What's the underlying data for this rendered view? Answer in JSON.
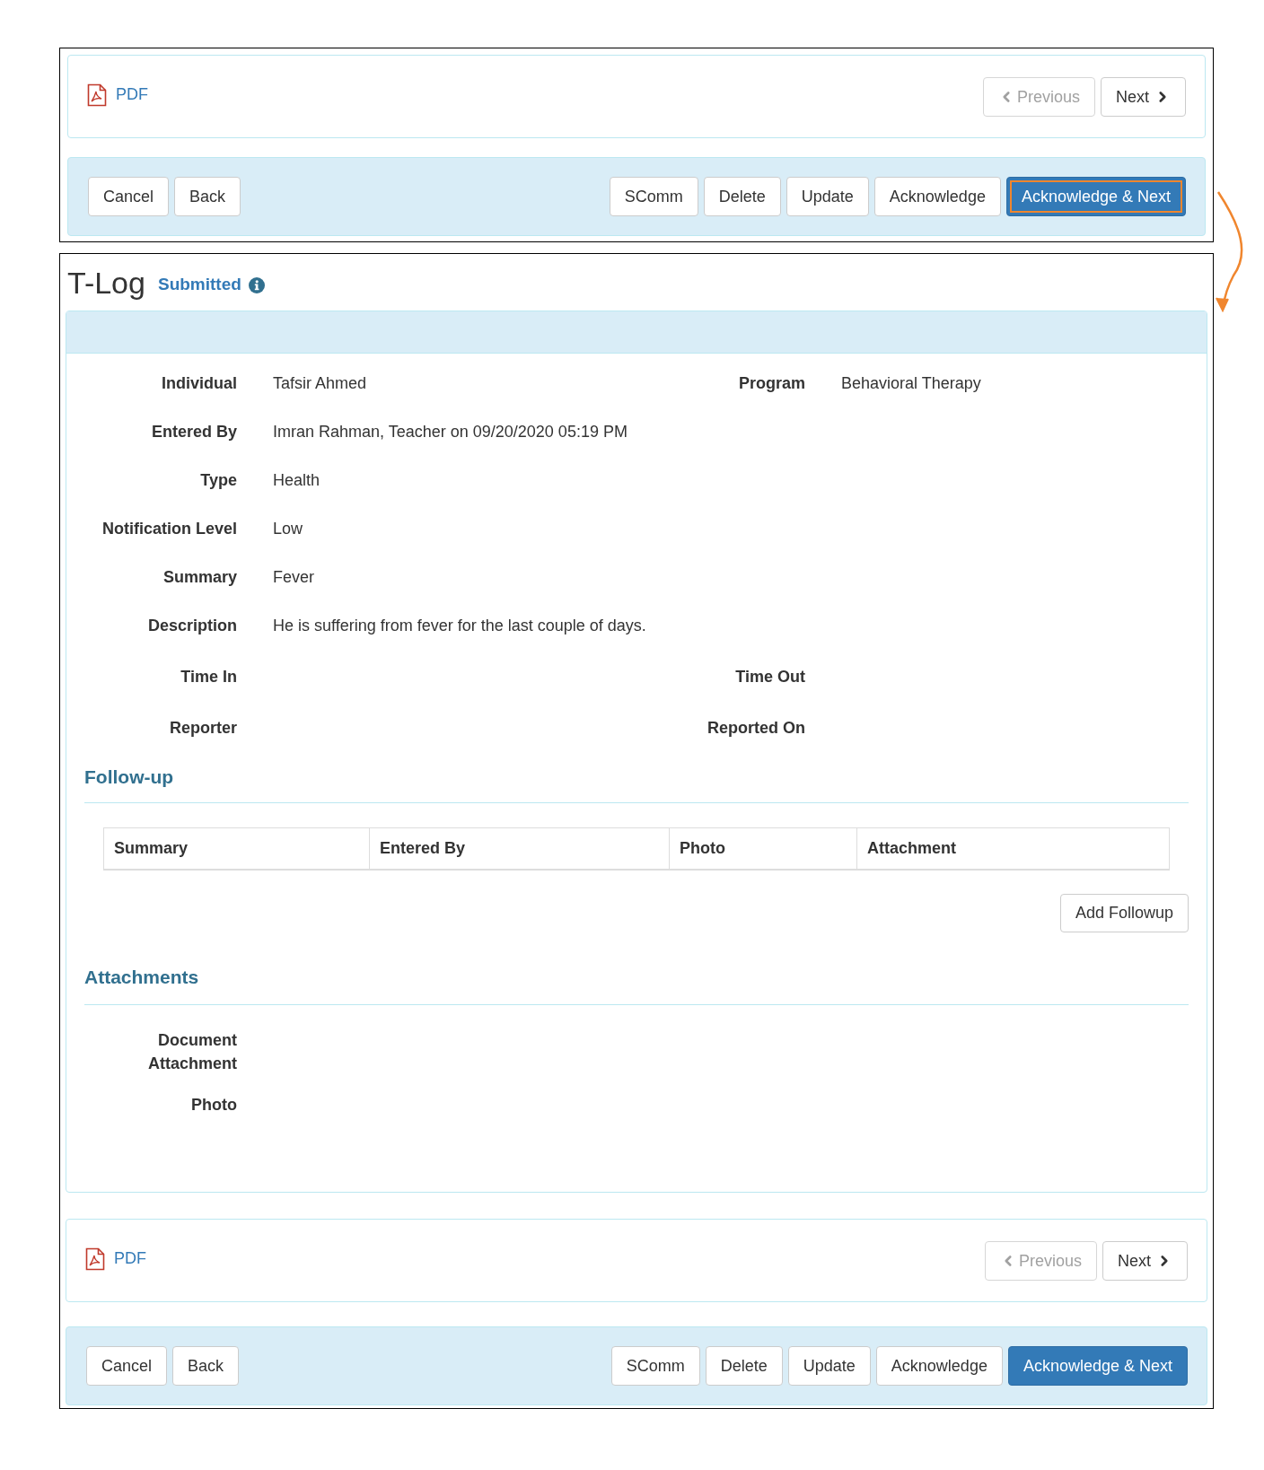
{
  "top_section": {
    "pdf_link": "PDF",
    "previous_button": {
      "label": "Previous",
      "disabled": true
    },
    "next_button": {
      "label": "Next",
      "disabled": false
    },
    "actions_left": [
      "Cancel",
      "Back"
    ],
    "actions_right": [
      {
        "label": "SComm",
        "kind": "default",
        "highlighted": false
      },
      {
        "label": "Delete",
        "kind": "default",
        "highlighted": false
      },
      {
        "label": "Update",
        "kind": "default",
        "highlighted": false
      },
      {
        "label": "Acknowledge",
        "kind": "default",
        "highlighted": false
      },
      {
        "label": "Acknowledge & Next",
        "kind": "primary",
        "highlighted": true
      }
    ]
  },
  "record": {
    "title": "T-Log",
    "status": "Submitted",
    "fields": [
      [
        {
          "label": "Individual",
          "value": "Tafsir Ahmed"
        },
        {
          "label": "Program",
          "value": "Behavioral Therapy"
        }
      ],
      [
        {
          "label": "Entered By",
          "value": "Imran Rahman, Teacher on 09/20/2020 05:19 PM"
        }
      ],
      [
        {
          "label": "Type",
          "value": "Health"
        }
      ],
      [
        {
          "label": "Notification Level",
          "value": "Low"
        }
      ],
      [
        {
          "label": "Summary",
          "value": "Fever"
        }
      ],
      [
        {
          "label": "Description",
          "value": "He is suffering from fever for the last couple of days."
        }
      ],
      [
        {
          "label": "Time In"
        },
        {
          "label": "Time Out"
        }
      ],
      [
        {
          "label": "Reporter"
        },
        {
          "label": "Reported On"
        }
      ]
    ],
    "followup": {
      "heading": "Follow-up",
      "columns": [
        "Summary",
        "Entered By",
        "Photo",
        "Attachment"
      ],
      "add_button": "Add Followup"
    },
    "attachments": {
      "heading": "Attachments",
      "fields": [
        "Document Attachment",
        "Photo"
      ]
    }
  },
  "bottom_section": {
    "pdf_link": "PDF",
    "previous_button": {
      "label": "Previous",
      "disabled": true
    },
    "next_button": {
      "label": "Next",
      "disabled": false
    },
    "actions_left": [
      "Cancel",
      "Back"
    ],
    "actions_right": [
      {
        "label": "SComm",
        "kind": "default",
        "highlighted": false
      },
      {
        "label": "Delete",
        "kind": "default",
        "highlighted": false
      },
      {
        "label": "Update",
        "kind": "default",
        "highlighted": false
      },
      {
        "label": "Acknowledge",
        "kind": "default",
        "highlighted": false
      },
      {
        "label": "Acknowledge & Next",
        "kind": "primary",
        "highlighted": false
      }
    ]
  }
}
